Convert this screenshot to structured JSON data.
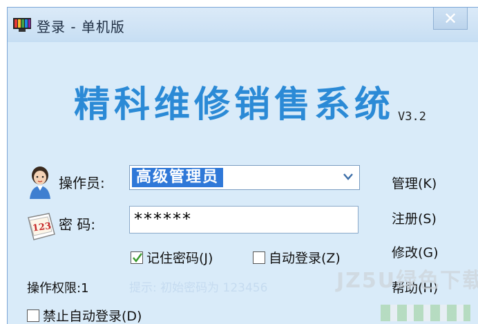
{
  "window": {
    "title": "登录 - 单机版",
    "close_symbol": "✕"
  },
  "app": {
    "name": "精科维修销售系统",
    "version": "V3.2"
  },
  "form": {
    "operator_label": "操作员:",
    "operator_value": "高级管理员",
    "password_label": "密  码:",
    "password_value": "******",
    "password_icon_text": "123",
    "remember_label": "记住密码(J)",
    "remember_checked": true,
    "autologin_label": "自动登录(Z)",
    "autologin_checked": false,
    "permission_label": "操作权限:1",
    "hint": "提示: 初始密码为 123456",
    "disable_autologin_label": "禁止自动登录(D)"
  },
  "side_buttons": {
    "manage": "管理(K)",
    "register": "注册(S)",
    "modify": "修改(G)",
    "help": "帮助(H)"
  },
  "watermark": {
    "text": "JZ5U绿色下载"
  },
  "icons": [
    "app-logo-icon",
    "close-icon",
    "user-avatar-icon",
    "password-card-icon",
    "dropdown-arrow-icon",
    "checkmark-icon"
  ],
  "colors": {
    "brand": "#2b8ad6",
    "window_bg": "#d9ebf9",
    "selection": "#2f78d8"
  }
}
